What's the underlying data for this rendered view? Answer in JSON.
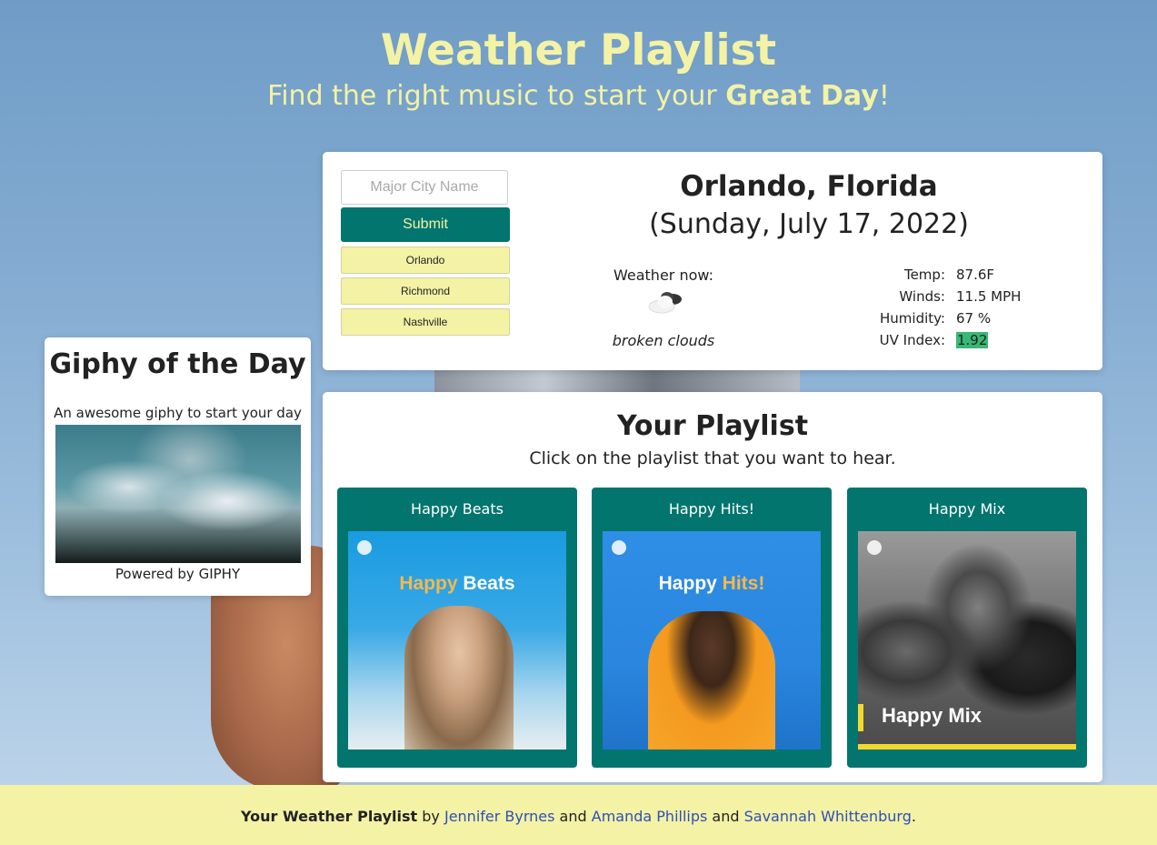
{
  "header": {
    "title": "Weather Playlist",
    "subtitle_prefix": "Find the right music to start your ",
    "subtitle_bold": "Great Day",
    "subtitle_suffix": "!"
  },
  "search": {
    "placeholder": "Major City Name",
    "submit_label": "Submit",
    "history": [
      "Orlando",
      "Richmond",
      "Nashville"
    ]
  },
  "weather": {
    "city": "Orlando, Florida",
    "date": "(Sunday, July 17, 2022)",
    "now_label": "Weather now:",
    "icon": "broken-clouds-icon",
    "description": "broken clouds",
    "temp_label": "Temp:",
    "temp_value": "87.6F",
    "wind_label": "Winds:",
    "wind_value": "11.5 MPH",
    "humidity_label": "Humidity:",
    "humidity_value": "67 %",
    "uv_label": "UV Index:",
    "uv_value": "1.92",
    "uv_color": "#38b874"
  },
  "giphy": {
    "title": "Giphy of the Day",
    "subtitle": "An awesome giphy to start your day",
    "credit": "Powered by GIPHY"
  },
  "playlist": {
    "title": "Your Playlist",
    "subtitle": "Click on the playlist that you want to hear.",
    "items": [
      {
        "name": "Happy Beats",
        "art_word1": "Happy",
        "art_word2": "Beats"
      },
      {
        "name": "Happy Hits!",
        "art_word1": "Happy",
        "art_word2": "Hits!"
      },
      {
        "name": "Happy Mix",
        "art_text": "Happy Mix"
      }
    ]
  },
  "footer": {
    "app_name": "Your Weather Playlist",
    "by": " by ",
    "and1": " and ",
    "and2": " and ",
    "period": ".",
    "authors": [
      "Jennifer Byrnes",
      "Amanda Phillips",
      "Savannah Whittenburg"
    ]
  },
  "colors": {
    "accent": "#03756f",
    "highlight": "#f3f2a5",
    "link": "#2f4fb8"
  }
}
